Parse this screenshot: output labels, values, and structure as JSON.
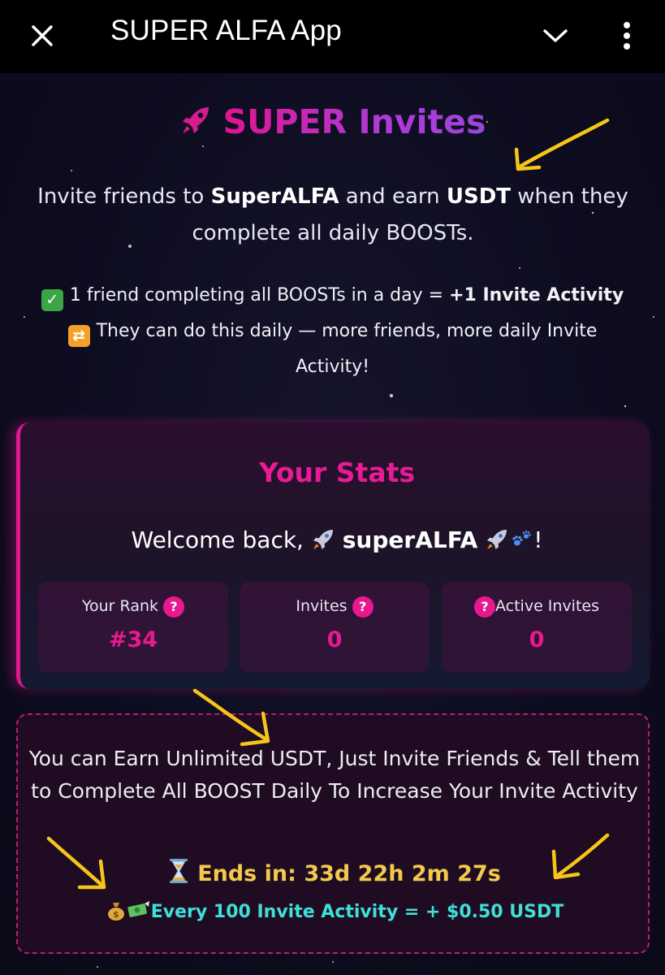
{
  "app_bar": {
    "title": "SUPER ALFA App",
    "close_icon": "close-icon",
    "collapse_icon": "chevron-down-icon",
    "menu_icon": "more-vert-icon"
  },
  "hero": {
    "title": "SUPER Invites",
    "lead_prefix": "Invite friends to ",
    "lead_brand": "SuperALFA",
    "lead_middle": " and earn ",
    "lead_currency": "USDT",
    "lead_suffix": " when they complete all daily BOOSTs."
  },
  "rules": {
    "line1_prefix": "1 friend completing all BOOSTs in a day = ",
    "line1_bold": "+1 Invite Activity",
    "line2_start": "They can do this daily — more friends, more daily Invite",
    "line2_end": "Activity!"
  },
  "stats": {
    "title": "Your Stats",
    "welcome_prefix": "Welcome back, ",
    "username": "superALFA",
    "welcome_suffix": "!",
    "rank_label": "Your Rank",
    "rank_value": "#34",
    "invites_label": "Invites",
    "invites_value": "0",
    "active_label": "Active Invites",
    "active_value": "0",
    "help_glyph": "?"
  },
  "promo": {
    "text": "You can Earn Unlimited USDT, Just Invite Friends & Tell them to Complete All BOOST Daily To Increase Your Invite Activity",
    "ends_label": "Ends in: 33d 22h 2m 27s",
    "reward": "Every 100 Invite Activity = + $0.50 USDT"
  },
  "colors": {
    "accent_pink": "#e8198f",
    "gold": "#f2c94c",
    "cyan": "#3fe0d8",
    "annotation_arrow": "#f5c518"
  }
}
